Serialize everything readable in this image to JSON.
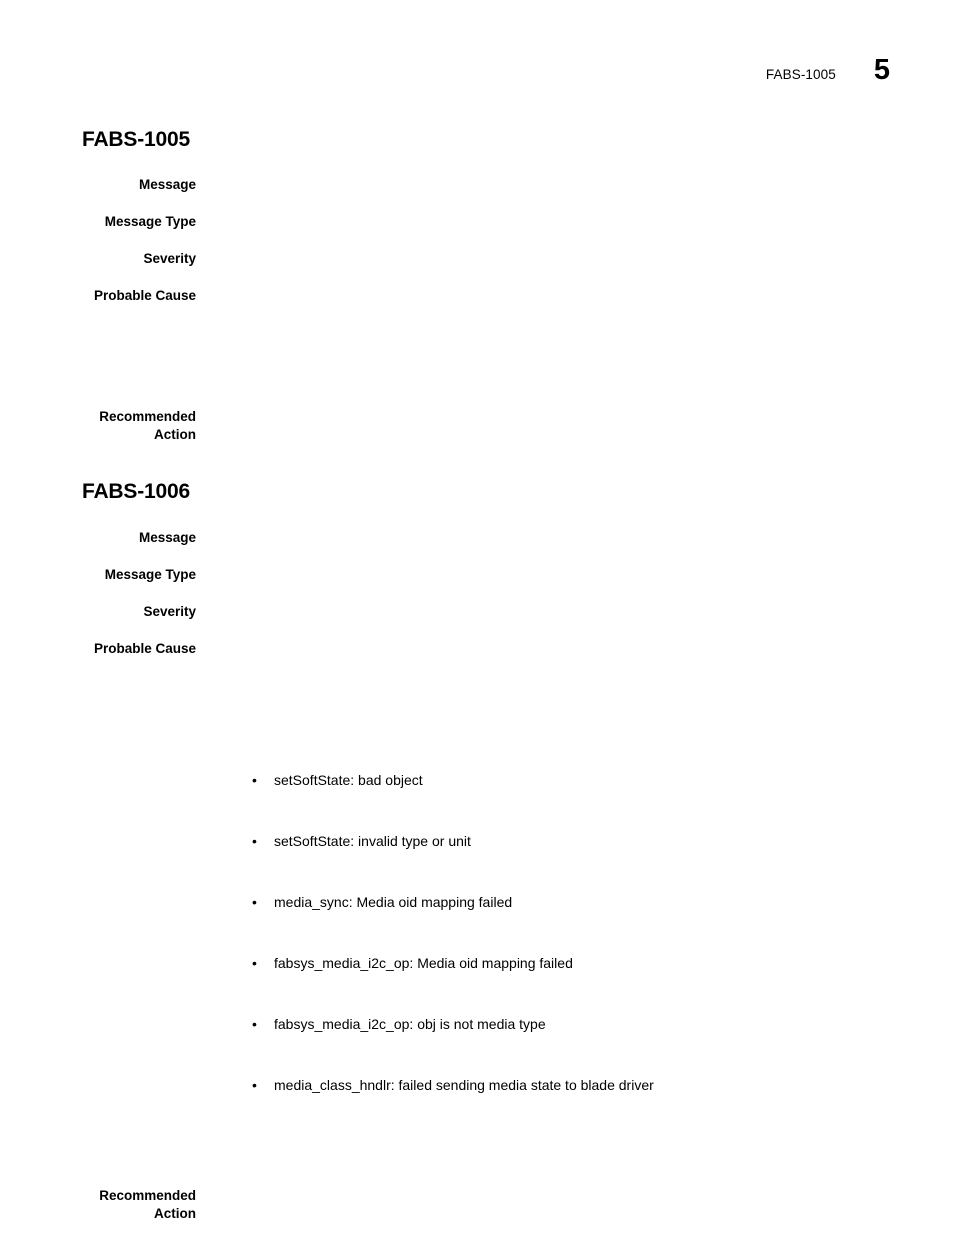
{
  "header": {
    "chapter": "FABS-1005",
    "page_number": "5"
  },
  "sections": [
    {
      "title": "FABS-1005",
      "fields": [
        {
          "label": "Message",
          "value": ""
        },
        {
          "label": "Message Type",
          "value": ""
        },
        {
          "label": "Severity",
          "value": ""
        },
        {
          "label": "Probable Cause",
          "value": ""
        },
        {
          "label": "Recommended\nAction",
          "value": ""
        }
      ],
      "causes": []
    },
    {
      "title": "FABS-1006",
      "fields": [
        {
          "label": "Message",
          "value": ""
        },
        {
          "label": "Message Type",
          "value": ""
        },
        {
          "label": "Severity",
          "value": ""
        },
        {
          "label": "Probable Cause",
          "value": ""
        }
      ],
      "causes": [
        "setSoftState: bad object",
        "setSoftState: invalid type or unit",
        "media_sync: Media oid mapping failed",
        "fabsys_media_i2c_op: Media oid mapping failed",
        "fabsys_media_i2c_op: obj is not media type",
        "media_class_hndlr: failed sending media state to blade driver"
      ],
      "trailing_fields": [
        {
          "label": "Recommended\nAction",
          "value": ""
        }
      ]
    }
  ],
  "bullet_glyph": "•"
}
